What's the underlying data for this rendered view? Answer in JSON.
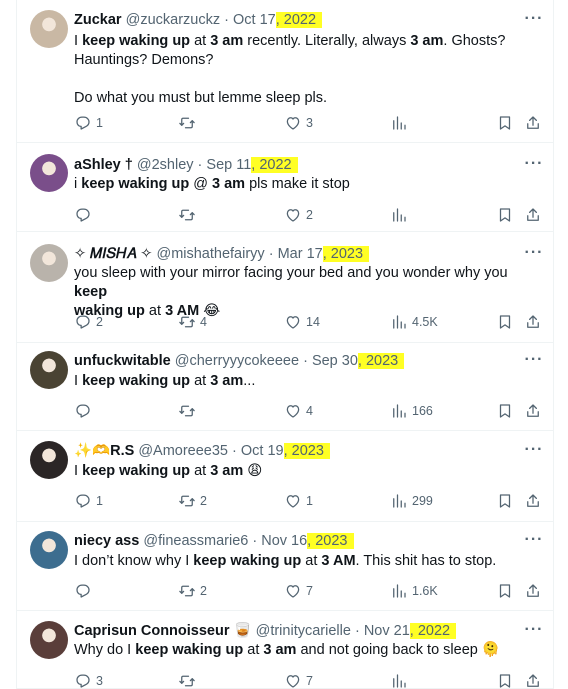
{
  "tweets": [
    {
      "name": "Zuckar",
      "handle": "@zuckarzuckz",
      "date_pre": "Oct 17",
      "date_year": ", 2022",
      "text_lines": [
        [
          {
            "t": "I "
          },
          {
            "t": "keep waking up",
            "b": true
          },
          {
            "t": " at "
          },
          {
            "t": "3 am",
            "b": true
          },
          {
            "t": " recently. Literally, always "
          },
          {
            "t": "3 am",
            "b": true
          },
          {
            "t": ". Ghosts?"
          }
        ],
        [
          {
            "t": "Hauntings? Demons?"
          }
        ],
        [
          {
            "t": ""
          }
        ],
        [
          {
            "t": "Do what you must but lemme sleep pls."
          }
        ]
      ],
      "replies": "1",
      "retweets": "",
      "likes": "3",
      "views": "",
      "avatar_color": "#c9b8a4"
    },
    {
      "name": "aShley †",
      "handle": "@2shley",
      "date_pre": "Sep 11",
      "date_year": ", 2022",
      "text_lines": [
        [
          {
            "t": "i "
          },
          {
            "t": "keep waking up",
            "b": true
          },
          {
            "t": " @ "
          },
          {
            "t": "3 am",
            "b": true
          },
          {
            "t": " pls make it stop"
          }
        ]
      ],
      "replies": "",
      "retweets": "",
      "likes": "2",
      "views": "",
      "avatar_color": "#7a4e8a"
    },
    {
      "name": "✧ 𝑀𝐼𝑆𝐻𝐴 ✧",
      "handle": "@mishathefairyy",
      "date_pre": "Mar 17",
      "date_year": ", 2023",
      "text_lines": [
        [
          {
            "t": "you sleep with your mirror facing your bed and you wonder why you "
          },
          {
            "t": "keep",
            "b": true
          }
        ],
        [
          {
            "t": "waking up",
            "b": true
          },
          {
            "t": " at "
          },
          {
            "t": "3 AM",
            "b": true
          },
          {
            "t": " 😂"
          }
        ]
      ],
      "replies": "2",
      "retweets": "4",
      "likes": "14",
      "views": "4.5K",
      "avatar_color": "#b9b3ab"
    },
    {
      "name": "unfuckwitable",
      "handle": "@cherryyycokeeee",
      "date_pre": "Sep 30",
      "date_year": ", 2023",
      "text_lines": [
        [
          {
            "t": "I "
          },
          {
            "t": "keep waking up",
            "b": true
          },
          {
            "t": " at "
          },
          {
            "t": "3 am",
            "b": true
          },
          {
            "t": "..."
          }
        ]
      ],
      "replies": "",
      "retweets": "",
      "likes": "4",
      "views": "166",
      "avatar_color": "#4a4333"
    },
    {
      "name": "✨🫶R.S",
      "handle": "@Amoreee35",
      "date_pre": "Oct 19",
      "date_year": ", 2023",
      "text_lines": [
        [
          {
            "t": "I "
          },
          {
            "t": "keep waking up",
            "b": true
          },
          {
            "t": " at "
          },
          {
            "t": "3 am",
            "b": true
          },
          {
            "t": " 😩"
          }
        ]
      ],
      "replies": "1",
      "retweets": "2",
      "likes": "1",
      "views": "299",
      "avatar_color": "#2b2626"
    },
    {
      "name": "niecy ass",
      "handle": "@fineassmarie6",
      "date_pre": "Nov 16",
      "date_year": ", 2023",
      "text_lines": [
        [
          {
            "t": "I don’t know why I "
          },
          {
            "t": "keep waking up",
            "b": true
          },
          {
            "t": " at "
          },
          {
            "t": "3 AM",
            "b": true
          },
          {
            "t": ". This shit has to stop."
          }
        ]
      ],
      "replies": "",
      "retweets": "2",
      "likes": "7",
      "views": "1.6K",
      "avatar_color": "#3d6d8f"
    },
    {
      "name": "Caprisun Connoisseur 🥃",
      "handle": "@trinitycarielle",
      "date_pre": "Nov 21",
      "date_year": ", 2022",
      "text_lines": [
        [
          {
            "t": "Why do I "
          },
          {
            "t": "keep waking up",
            "b": true
          },
          {
            "t": " at "
          },
          {
            "t": "3 am",
            "b": true
          },
          {
            "t": " and not going back to sleep 🫠"
          }
        ]
      ],
      "replies": "3",
      "retweets": "",
      "likes": "7",
      "views": "",
      "avatar_color": "#5a3e3a"
    }
  ],
  "colors": {
    "highlight": "#ffff24",
    "muted": "#536471",
    "text": "#0f1419",
    "border": "#eff3f4"
  },
  "icons": [
    "reply-icon",
    "retweet-icon",
    "like-icon",
    "views-icon",
    "bookmark-icon",
    "share-icon",
    "more-icon"
  ]
}
